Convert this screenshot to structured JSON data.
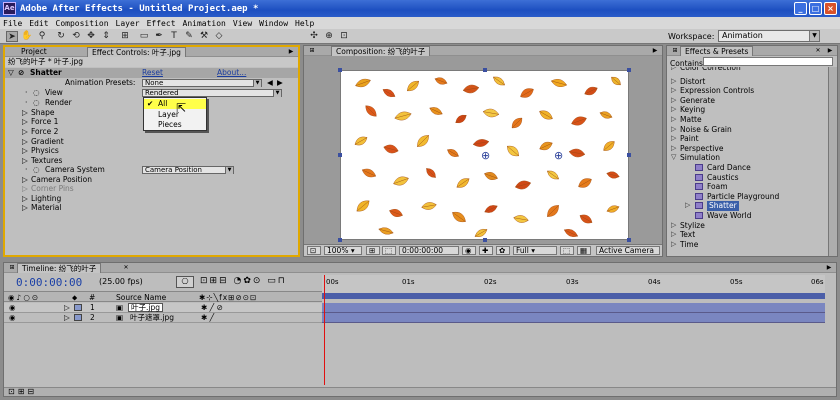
{
  "window": {
    "title": "Adobe After Effects - Untitled Project.aep *",
    "logo": "Ae",
    "buttons": [
      "_",
      "□",
      "×"
    ]
  },
  "menu": [
    "File",
    "Edit",
    "Composition",
    "Layer",
    "Effect",
    "Animation",
    "View",
    "Window",
    "Help"
  ],
  "toolbar": {
    "workspace_label": "Workspace:",
    "workspace_value": "Animation",
    "icons": [
      "selection-arrow-icon",
      "hand-icon",
      "zoom-icon",
      "rotate-icon",
      "orbit-camera-icon",
      "track-xy-icon",
      "track-z-icon",
      "pan-behind-icon",
      "rectangle-mask-icon",
      "pen-icon",
      "text-icon",
      "brush-icon",
      "clone-stamp-icon",
      "eraser-icon",
      "axis-icon"
    ]
  },
  "effect_controls": {
    "tabs": [
      "Project",
      "Effect Controls: 叶子.jpg"
    ],
    "header": "纷飞的叶子 * 叶子.jpg",
    "effect_name": "Shatter",
    "reset": "Reset",
    "about": "About...",
    "presets_label": "Animation Presets:",
    "presets_value": "None",
    "rows": [
      {
        "label": "View",
        "value": "Rendered",
        "indent": 2
      },
      {
        "label": "Render",
        "value": "",
        "indent": 2
      },
      {
        "label": "Shape",
        "indent": 1
      },
      {
        "label": "Force 1",
        "indent": 1
      },
      {
        "label": "Force 2",
        "indent": 1
      },
      {
        "label": "Gradient",
        "indent": 1
      },
      {
        "label": "Physics",
        "indent": 1
      },
      {
        "label": "Textures",
        "indent": 1
      },
      {
        "label": "Camera System",
        "value": "Camera Position",
        "indent": 2
      },
      {
        "label": "Camera Position",
        "indent": 1
      },
      {
        "label": "Corner Pins",
        "indent": 1,
        "dim": true
      },
      {
        "label": "Lighting",
        "indent": 1
      },
      {
        "label": "Material",
        "indent": 1
      }
    ],
    "dropdown": {
      "options": [
        "All",
        "Layer",
        "Pieces"
      ],
      "selected": "All"
    }
  },
  "composition": {
    "tab": "Composition: 纷飞的叶子",
    "zoom": "100%",
    "timecode": "0:00:00:00",
    "resolution": "Full",
    "camera": "Active Camera"
  },
  "effects_presets": {
    "tab": "Effects & Presets",
    "contains_label": "Contains:",
    "items": [
      {
        "label": "Color Correction",
        "type": "folder",
        "cut": true
      },
      {
        "label": "Distort",
        "type": "folder"
      },
      {
        "label": "Expression Controls",
        "type": "folder"
      },
      {
        "label": "Generate",
        "type": "folder"
      },
      {
        "label": "Keying",
        "type": "folder"
      },
      {
        "label": "Matte",
        "type": "folder"
      },
      {
        "label": "Noise & Grain",
        "type": "folder"
      },
      {
        "label": "Paint",
        "type": "folder"
      },
      {
        "label": "Perspective",
        "type": "folder"
      },
      {
        "label": "Simulation",
        "type": "folder",
        "open": true
      },
      {
        "label": "Card Dance",
        "type": "effect"
      },
      {
        "label": "Caustics",
        "type": "effect"
      },
      {
        "label": "Foam",
        "type": "effect"
      },
      {
        "label": "Particle Playground",
        "type": "effect"
      },
      {
        "label": "Shatter",
        "type": "effect",
        "selected": true
      },
      {
        "label": "Wave World",
        "type": "effect"
      },
      {
        "label": "Stylize",
        "type": "folder"
      },
      {
        "label": "Text",
        "type": "folder"
      },
      {
        "label": "Time",
        "type": "folder"
      }
    ]
  },
  "timeline": {
    "tab": "Timeline: 纷飞的叶子",
    "time": "0:00:00:00",
    "fps": "(25.00 fps)",
    "column_source": "Source Name",
    "ticks": [
      "00s",
      "01s",
      "02s",
      "03s",
      "04s",
      "05s",
      "06s"
    ],
    "layers": [
      {
        "num": "1",
        "name": "叶子.jpg",
        "selected": true
      },
      {
        "num": "2",
        "name": "叶子遮罩.jpg",
        "selected": false
      }
    ]
  }
}
